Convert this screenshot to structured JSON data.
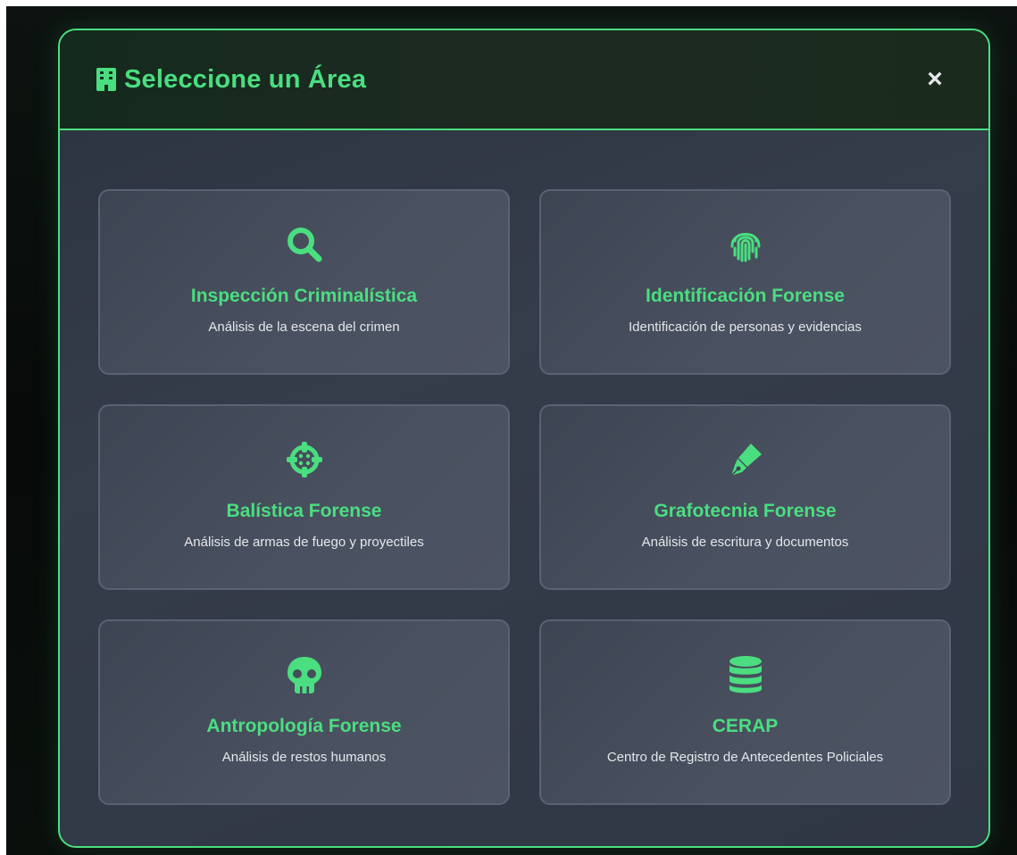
{
  "modal": {
    "title": "Seleccione un Área",
    "title_icon": "building-icon",
    "close_label": "×",
    "accent_color": "#4ade80"
  },
  "areas": [
    {
      "title": "Inspección Criminalística",
      "description": "Análisis de la escena del crimen",
      "icon": "search-icon"
    },
    {
      "title": "Identificación Forense",
      "description": "Identificación de personas y evidencias",
      "icon": "fingerprint-icon"
    },
    {
      "title": "Balística Forense",
      "description": "Análisis de armas de fuego y proyectiles",
      "icon": "crosshairs-icon"
    },
    {
      "title": "Grafotecnia Forense",
      "description": "Análisis de escritura y documentos",
      "icon": "pen-nib-icon"
    },
    {
      "title": "Antropología Forense",
      "description": "Análisis de restos humanos",
      "icon": "skull-icon"
    },
    {
      "title": "CERAP",
      "description": "Centro de Registro de Antecedentes Policiales",
      "icon": "database-icon"
    }
  ]
}
